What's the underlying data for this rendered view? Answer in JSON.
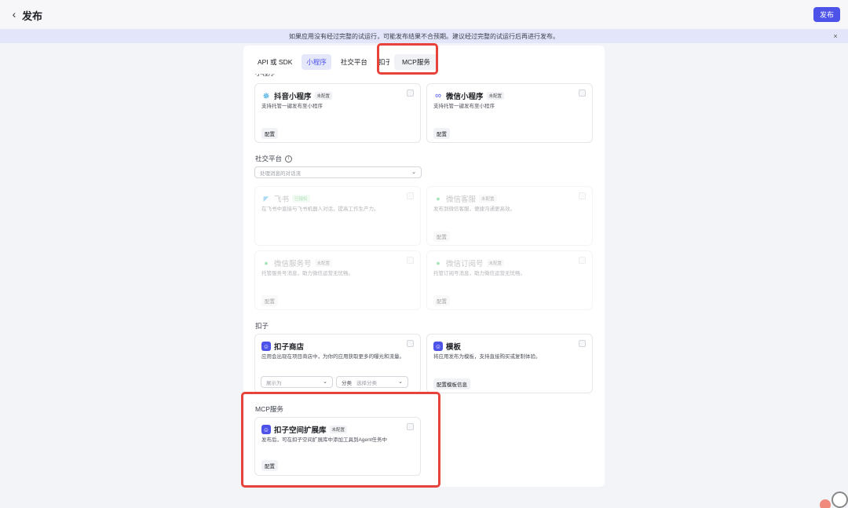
{
  "header": {
    "back_icon": "chevron-left-icon",
    "title": "发布",
    "publish_button": "发布"
  },
  "banner": {
    "text": "如果应用没有经过完整的试运行，可能发布结果不合预期。建议经过完整的试运行后再进行发布。",
    "close_icon": "×"
  },
  "tabs": [
    {
      "label": "API 或 SDK"
    },
    {
      "label": "小程序"
    },
    {
      "label": "社交平台"
    },
    {
      "label": "扣子"
    },
    {
      "label": "MCP服务"
    }
  ],
  "sections": {
    "mini_program": "小程序",
    "social": "社交平台",
    "coze": "扣子",
    "mcp": "MCP服务"
  },
  "social_select_placeholder": "处理消息的对话流",
  "cards": {
    "douyin": {
      "name": "抖音小程序",
      "badge": "未配置",
      "desc": "支持托管一键发布至小程序",
      "config": "配置"
    },
    "wechat_mini": {
      "name": "微信小程序",
      "badge": "未配置",
      "desc": "支持托管一键发布至小程序",
      "config": "配置"
    },
    "feishu": {
      "name": "飞书",
      "badge": "已授权",
      "desc": "在飞书中直接与飞书机器人对话，提高工作生产力。"
    },
    "wechat_kefu": {
      "name": "微信客服",
      "badge": "未配置",
      "desc": "发布到微信客服，便捷沟通更高效。",
      "config": "配置"
    },
    "wechat_service": {
      "name": "微信服务号",
      "badge": "未配置",
      "desc": "托管服务号消息，助力微信运营无忧畅。",
      "config": "配置"
    },
    "wechat_sub": {
      "name": "微信订阅号",
      "badge": "未配置",
      "desc": "托管订阅号消息，助力微信运营无忧畅。",
      "config": "配置"
    },
    "coze_store": {
      "name": "扣子商店",
      "desc": "应用会出现在项目商店中，为你的应用获取更多的曝光和流量。",
      "display_placeholder": "展示为",
      "category_prefix": "分类",
      "category_placeholder": "选择分类"
    },
    "template": {
      "name": "模板",
      "desc": "将应用发布为模板，支持直接购买或复制体验。",
      "config": "配置模板信息"
    },
    "mcp_ext": {
      "name": "扣子空间扩展库",
      "badge": "未配置",
      "desc": "发布后，可在扣子空间扩展库中添加工具到Agent任务中",
      "config": "配置"
    }
  },
  "colors": {
    "accent": "#4d53e8",
    "highlight": "#e8433b",
    "banner_bg": "#e3e6fb"
  }
}
